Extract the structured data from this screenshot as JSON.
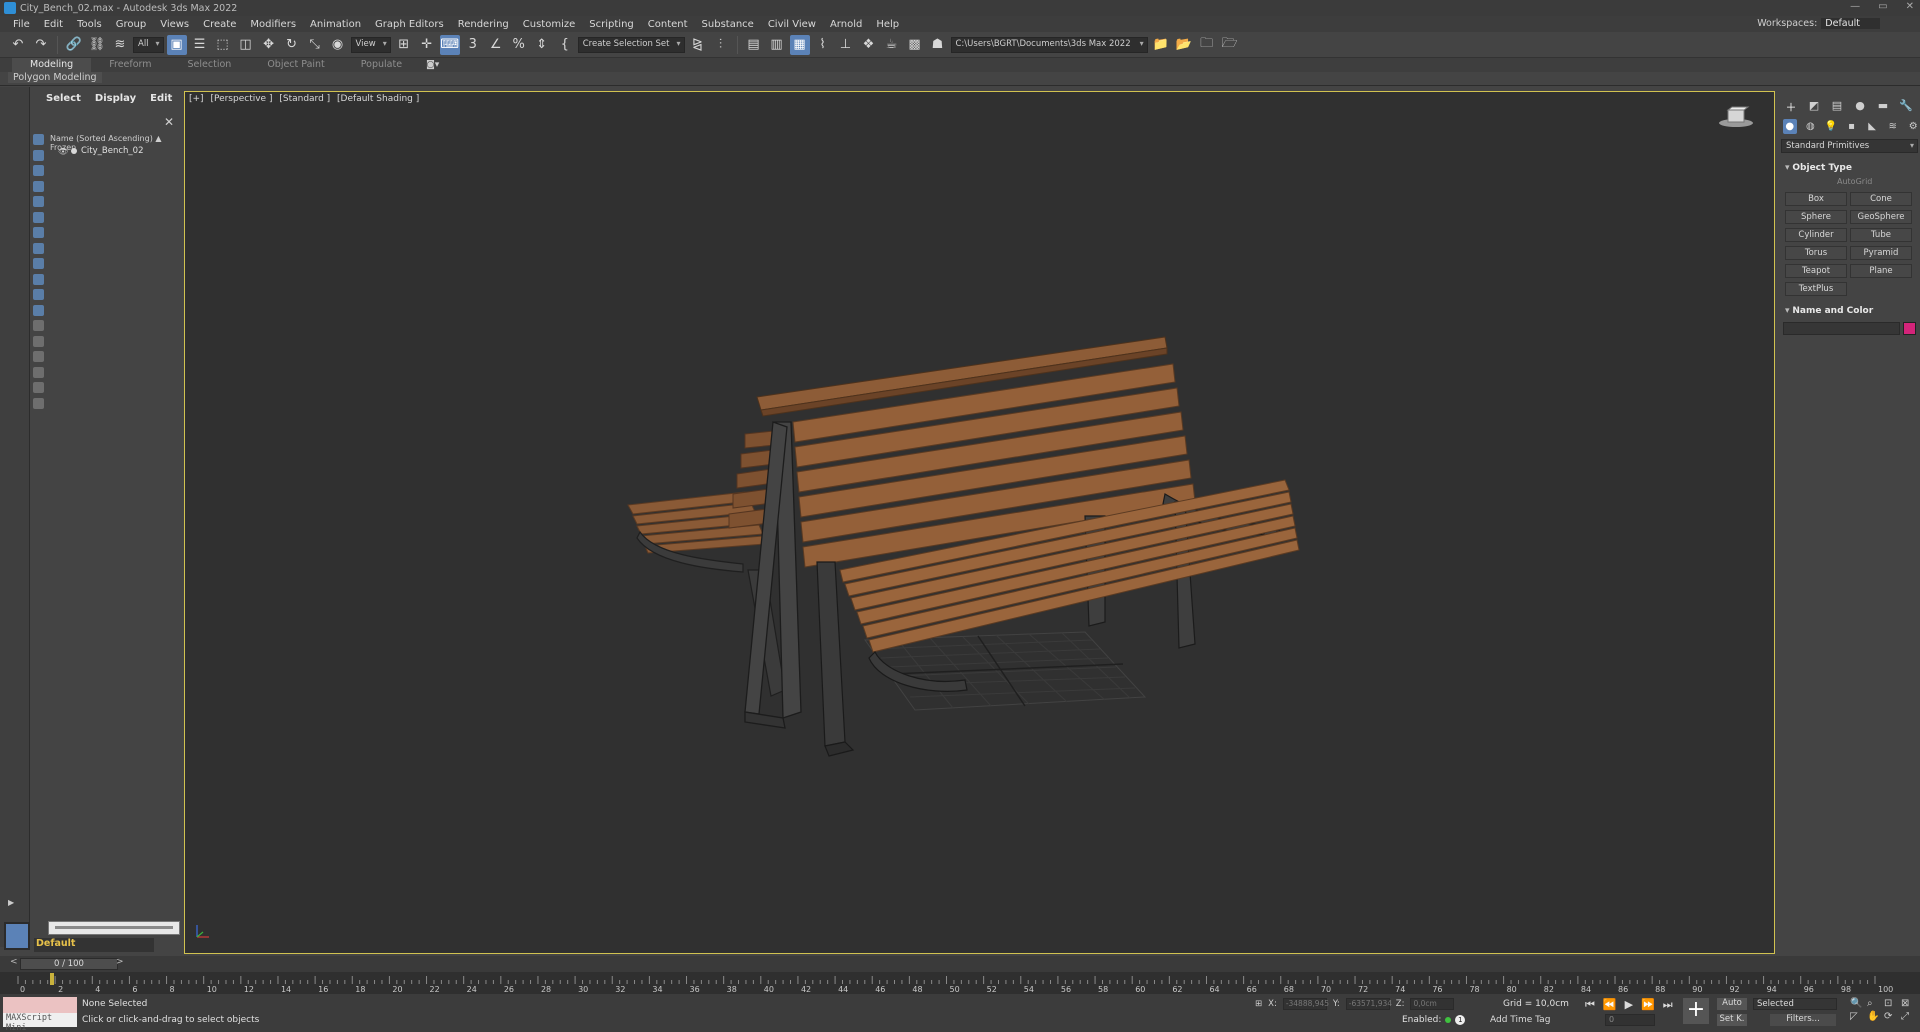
{
  "window": {
    "title": "City_Bench_02.max - Autodesk 3ds Max 2022",
    "controls": [
      "—",
      "▭",
      "✕"
    ]
  },
  "menu": {
    "items": [
      "File",
      "Edit",
      "Tools",
      "Group",
      "Views",
      "Create",
      "Modifiers",
      "Animation",
      "Graph Editors",
      "Rendering",
      "Customize",
      "Scripting",
      "Content",
      "Substance",
      "Civil View",
      "Arnold",
      "Help"
    ],
    "workspace_label": "Workspaces:",
    "workspace_value": "Default"
  },
  "toolbar": {
    "filter_value": "All",
    "refcoord_value": "View",
    "selection_set": "Create Selection Set",
    "project_path": "C:\\Users\\BGRT\\Documents\\3ds Max 2022"
  },
  "ribbon": {
    "tabs": [
      "Modeling",
      "Freeform",
      "Selection",
      "Object Paint",
      "Populate"
    ],
    "active_tab": "Modeling",
    "sub_label": "Polygon Modeling"
  },
  "scene_explorer": {
    "tabs": [
      "Select",
      "Display",
      "Edit"
    ],
    "column_header": "Name (Sorted Ascending) ▲ Frozen",
    "rows": [
      {
        "name": "City_Bench_02"
      }
    ],
    "layer_name": "Default"
  },
  "viewport": {
    "label_parts": [
      "[+]",
      "[Perspective ]",
      "[Standard ]",
      "[Default Shading ]"
    ]
  },
  "command_panel": {
    "category_dropdown": "Standard Primitives",
    "object_type_title": "Object Type",
    "autogrid_label": "AutoGrid",
    "primitives": [
      "Box",
      "Cone",
      "Sphere",
      "GeoSphere",
      "Cylinder",
      "Tube",
      "Torus",
      "Pyramid",
      "Teapot",
      "Plane",
      "TextPlus"
    ],
    "name_color_title": "Name and Color",
    "object_color": "#d4247a"
  },
  "time_slider": {
    "frame_display": "0 / 100"
  },
  "track_bar": {
    "tick_labels": [
      "0",
      "2",
      "4",
      "6",
      "8",
      "10",
      "12",
      "14",
      "16",
      "18",
      "20",
      "22",
      "24",
      "26",
      "28",
      "30",
      "32",
      "34",
      "36",
      "38",
      "40",
      "42",
      "44",
      "46",
      "48",
      "50",
      "52",
      "54",
      "56",
      "58",
      "60",
      "62",
      "64",
      "66",
      "68",
      "70",
      "72",
      "74",
      "76",
      "78",
      "80",
      "82",
      "84",
      "86",
      "88",
      "90",
      "92",
      "94",
      "96",
      "98",
      "100"
    ]
  },
  "status": {
    "maxscript_label": "MAXScript Mini",
    "selection": "None Selected",
    "hint": "Click or click-and-drag to select objects",
    "x_label": "X:",
    "x_value": "-34888,945",
    "y_label": "Y:",
    "y_value": "-63571,934",
    "z_label": "Z:",
    "z_value": "0,0cm",
    "grid": "Grid = 10,0cm",
    "enabled_label": "Enabled:",
    "enabled_num": "1",
    "add_time_tag": "Add Time Tag",
    "frame_value": "0",
    "auto_label": "Auto",
    "setk_label": "Set K.",
    "selected_dropdown": "Selected",
    "filters_label": "Filters..."
  }
}
